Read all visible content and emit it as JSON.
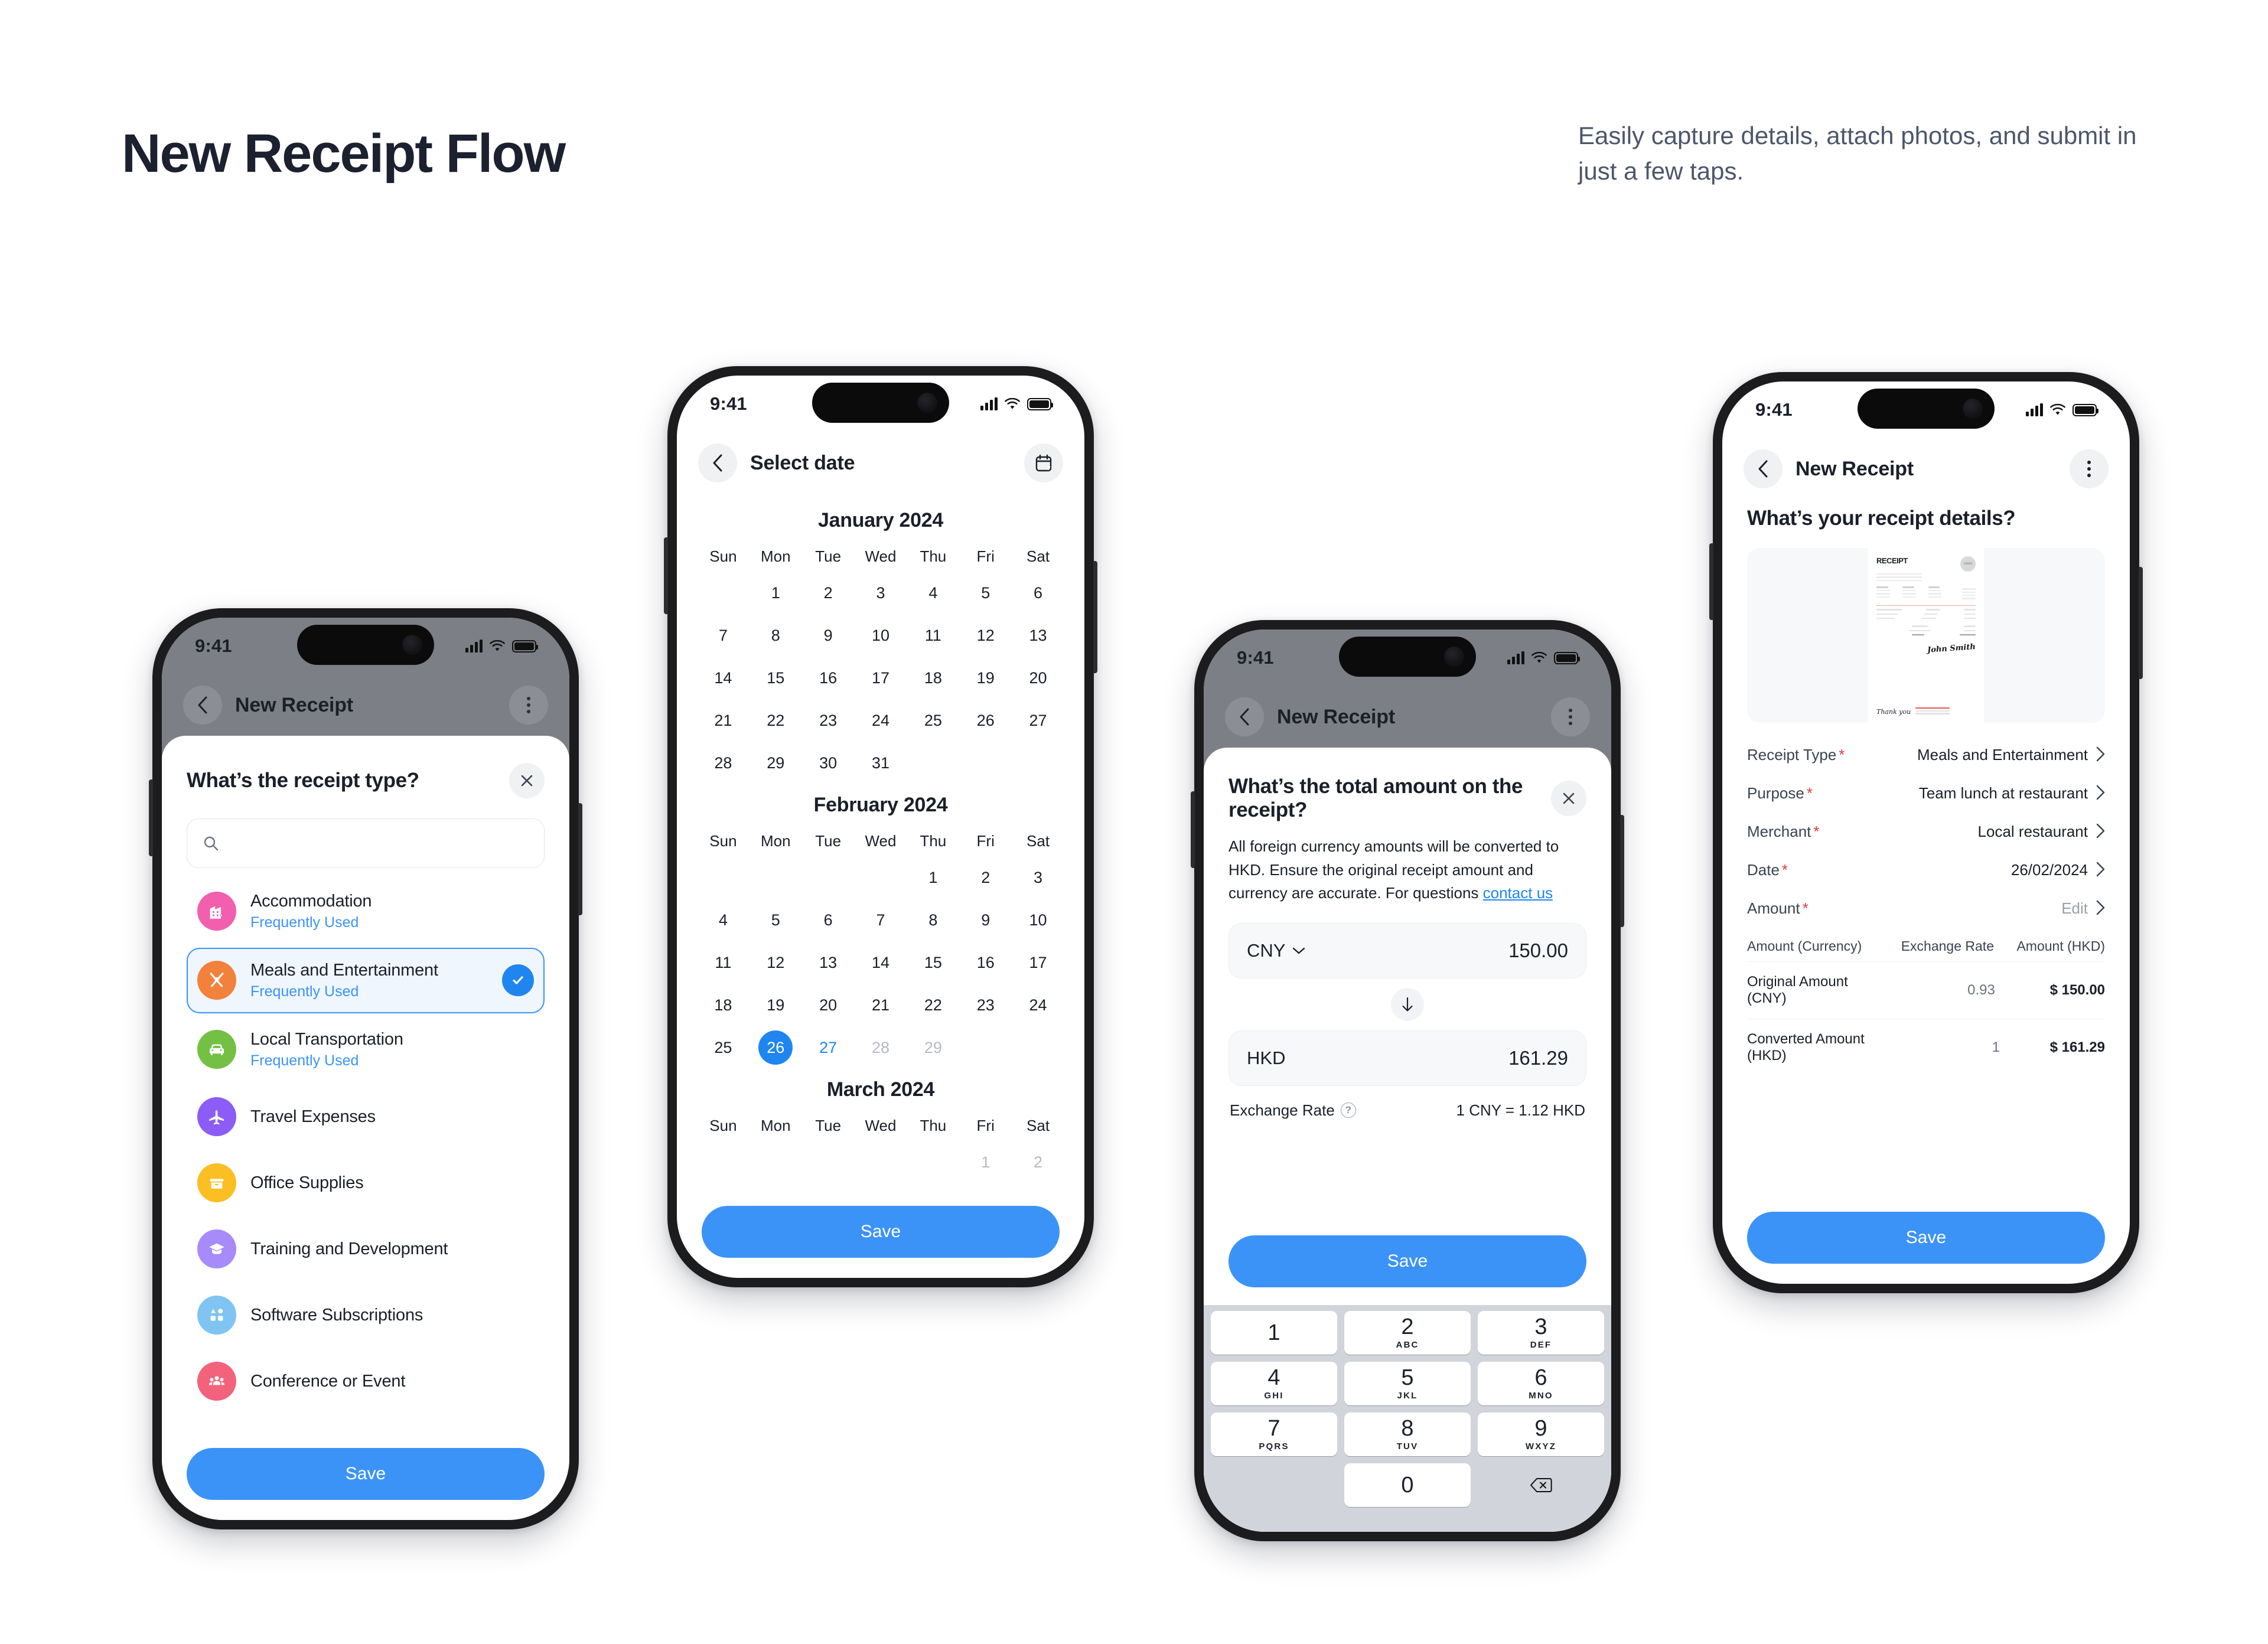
{
  "header": {
    "title": "New Receipt Flow",
    "subtitle": "Easily capture details, attach photos, and submit in just a few taps."
  },
  "theme": {
    "accent_blue": "#3b93f7",
    "selected_blue": "#1f86f0",
    "selected_row_bg": "#eff6fe",
    "required_red": "#e63946"
  },
  "status_bar": {
    "time": "9:41"
  },
  "phone1": {
    "nav": {
      "title": "New Receipt",
      "back_icon": "chevron-left-icon",
      "menu_icon": "overflow-menu-icon"
    },
    "sheet": {
      "title": "What’s the receipt type?",
      "close_icon": "close-icon",
      "search_placeholder": "",
      "search_value": "",
      "categories": [
        {
          "label": "Accommodation",
          "sub": "Frequently Used",
          "color": "#f25fae",
          "icon": "building-icon",
          "selected": false
        },
        {
          "label": "Meals and Entertainment",
          "sub": "Frequently Used",
          "color": "#f2813c",
          "icon": "cutlery-icon",
          "selected": true
        },
        {
          "label": "Local Transportation",
          "sub": "Frequently Used",
          "color": "#74c044",
          "icon": "car-icon",
          "selected": false
        },
        {
          "label": "Travel Expenses",
          "sub": "",
          "color": "#8b5cf6",
          "icon": "airplane-icon",
          "selected": false
        },
        {
          "label": "Office Supplies",
          "sub": "",
          "color": "#fbbf24",
          "icon": "box-icon",
          "selected": false
        },
        {
          "label": "Training and Development",
          "sub": "",
          "color": "#a78bfa",
          "icon": "graduation-icon",
          "selected": false
        },
        {
          "label": "Software Subscriptions",
          "sub": "",
          "color": "#7fc4f2",
          "icon": "apps-icon",
          "selected": false
        },
        {
          "label": "Conference or Event",
          "sub": "",
          "color": "#f2637b",
          "icon": "people-icon",
          "selected": false
        }
      ],
      "save_label": "Save"
    }
  },
  "phone2": {
    "nav": {
      "title": "Select date",
      "back_icon": "chevron-left-icon",
      "calendar_icon": "calendar-icon"
    },
    "weekdays": [
      "Sun",
      "Mon",
      "Tue",
      "Wed",
      "Thu",
      "Fri",
      "Sat"
    ],
    "months": [
      {
        "title": "January 2024",
        "lead_blanks": 1,
        "days": [
          {
            "n": "1"
          },
          {
            "n": "2"
          },
          {
            "n": "3"
          },
          {
            "n": "4"
          },
          {
            "n": "5"
          },
          {
            "n": "6"
          },
          {
            "n": "7"
          },
          {
            "n": "8"
          },
          {
            "n": "9"
          },
          {
            "n": "10"
          },
          {
            "n": "11"
          },
          {
            "n": "12"
          },
          {
            "n": "13"
          },
          {
            "n": "14"
          },
          {
            "n": "15"
          },
          {
            "n": "16"
          },
          {
            "n": "17"
          },
          {
            "n": "18"
          },
          {
            "n": "19"
          },
          {
            "n": "20"
          },
          {
            "n": "21"
          },
          {
            "n": "22"
          },
          {
            "n": "23"
          },
          {
            "n": "24"
          },
          {
            "n": "25"
          },
          {
            "n": "26"
          },
          {
            "n": "27"
          },
          {
            "n": "28"
          },
          {
            "n": "29"
          },
          {
            "n": "30"
          },
          {
            "n": "31"
          }
        ]
      },
      {
        "title": "February 2024",
        "lead_blanks": 4,
        "days": [
          {
            "n": "1"
          },
          {
            "n": "2"
          },
          {
            "n": "3"
          },
          {
            "n": "4"
          },
          {
            "n": "5"
          },
          {
            "n": "6"
          },
          {
            "n": "7"
          },
          {
            "n": "8"
          },
          {
            "n": "9"
          },
          {
            "n": "10"
          },
          {
            "n": "11"
          },
          {
            "n": "12"
          },
          {
            "n": "13"
          },
          {
            "n": "14"
          },
          {
            "n": "15"
          },
          {
            "n": "16"
          },
          {
            "n": "17"
          },
          {
            "n": "18"
          },
          {
            "n": "19"
          },
          {
            "n": "20"
          },
          {
            "n": "21"
          },
          {
            "n": "22"
          },
          {
            "n": "23"
          },
          {
            "n": "24"
          },
          {
            "n": "25"
          },
          {
            "n": "26",
            "state": "selected"
          },
          {
            "n": "27",
            "state": "accent"
          },
          {
            "n": "28",
            "state": "muted"
          },
          {
            "n": "29",
            "state": "muted"
          }
        ]
      },
      {
        "title": "March 2024",
        "lead_blanks": 5,
        "days": [
          {
            "n": "1",
            "state": "muted"
          },
          {
            "n": "2",
            "state": "muted"
          }
        ]
      }
    ],
    "save_label": "Save"
  },
  "phone3": {
    "nav": {
      "title": "New Receipt",
      "back_icon": "chevron-left-icon",
      "menu_icon": "overflow-menu-icon"
    },
    "sheet": {
      "title": "What’s the total amount on the receipt?",
      "close_icon": "close-icon",
      "description_prefix": "All foreign currency amounts will be converted to HKD. Ensure the original receipt amount and currency are accurate. For questions ",
      "description_link": "contact us",
      "from_currency": "CNY",
      "from_amount": "150.00",
      "swap_icon": "arrow-down-icon",
      "to_currency": "HKD",
      "to_amount": "161.29",
      "rate_label": "Exchange Rate",
      "rate_help_icon": "help-circle-icon",
      "rate_value": "1 CNY = 1.12 HKD",
      "save_label": "Save"
    },
    "keypad": {
      "keys": [
        {
          "num": "1",
          "sub": ""
        },
        {
          "num": "2",
          "sub": "ABC"
        },
        {
          "num": "3",
          "sub": "DEF"
        },
        {
          "num": "4",
          "sub": "GHI"
        },
        {
          "num": "5",
          "sub": "JKL"
        },
        {
          "num": "6",
          "sub": "MNO"
        },
        {
          "num": "7",
          "sub": "PQRS"
        },
        {
          "num": "8",
          "sub": "TUV"
        },
        {
          "num": "9",
          "sub": "WXYZ"
        },
        {
          "num": "0",
          "sub": ""
        }
      ],
      "backspace_icon": "backspace-icon"
    }
  },
  "phone4": {
    "nav": {
      "title": "New Receipt",
      "back_icon": "chevron-left-icon",
      "menu_icon": "overflow-menu-icon"
    },
    "title": "What’s your receipt details?",
    "thumbnail": {
      "icon": "receipt-thumbnail",
      "heading": "RECEIPT",
      "logo_text": "LOGO",
      "signature": "John Smith",
      "thanks": "Thank you"
    },
    "fields": [
      {
        "label": "Receipt Type",
        "required": true,
        "value": "Meals and Entertainment",
        "muted": false,
        "chevron": "chevron-right-icon"
      },
      {
        "label": "Purpose",
        "required": true,
        "value": "Team lunch at restaurant",
        "muted": false,
        "chevron": "chevron-right-icon"
      },
      {
        "label": "Merchant",
        "required": true,
        "value": "Local restaurant",
        "muted": false,
        "chevron": "chevron-right-icon"
      },
      {
        "label": "Date",
        "required": true,
        "value": "26/02/2024",
        "muted": false,
        "chevron": "chevron-right-icon"
      },
      {
        "label": "Amount",
        "required": true,
        "value": "Edit",
        "muted": true,
        "chevron": "chevron-right-icon"
      }
    ],
    "table": {
      "headers": [
        "Amount (Currency)",
        "Exchange Rate",
        "Amount (HKD)"
      ],
      "rows": [
        [
          "Original Amount (CNY)",
          "0.93",
          "$ 150.00"
        ],
        [
          "Converted Amount (HKD)",
          "1",
          "$ 161.29"
        ]
      ]
    },
    "save_label": "Save"
  }
}
